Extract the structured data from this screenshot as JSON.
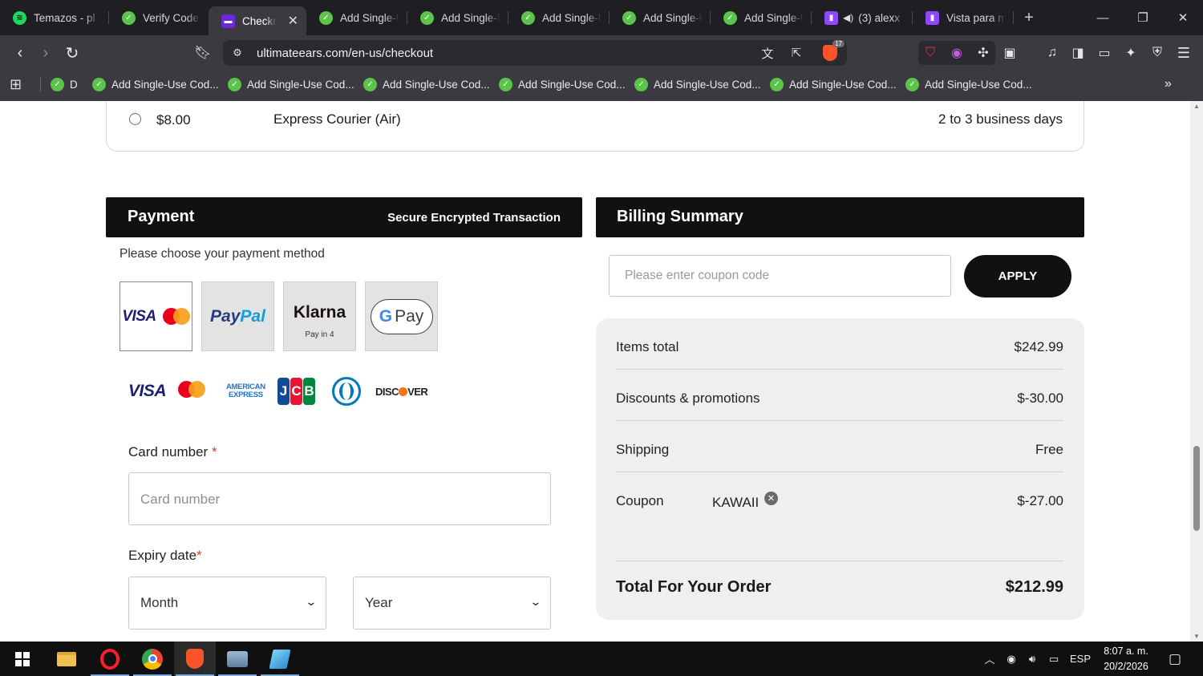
{
  "browser": {
    "tabs": [
      {
        "title": "Temazos - pl",
        "favicon": "spotify-icon",
        "active": false
      },
      {
        "title": "Verify Codes",
        "favicon": "check-icon",
        "active": false
      },
      {
        "title": "Checkout",
        "favicon": "checkout-icon",
        "active": true
      },
      {
        "title": "Add Single-U",
        "favicon": "check-icon",
        "active": false
      },
      {
        "title": "Add Single-U",
        "favicon": "check-icon",
        "active": false
      },
      {
        "title": "Add Single-U",
        "favicon": "check-icon",
        "active": false
      },
      {
        "title": "Add Single-U",
        "favicon": "check-icon",
        "active": false
      },
      {
        "title": "Add Single-U",
        "favicon": "check-icon",
        "active": false
      },
      {
        "title": "(3) alexx",
        "favicon": "twitch-icon",
        "active": false
      },
      {
        "title": "Vista para m",
        "favicon": "twitch-icon",
        "active": false
      }
    ],
    "url": "ultimateears.com/en-us/checkout",
    "brave_shield_count": "17",
    "bookmarks": [
      {
        "label": "D"
      },
      {
        "label": "Add Single-Use Cod..."
      },
      {
        "label": "Add Single-Use Cod..."
      },
      {
        "label": "Add Single-Use Cod..."
      },
      {
        "label": "Add Single-Use Cod..."
      },
      {
        "label": "Add Single-Use Cod..."
      },
      {
        "label": "Add Single-Use Cod..."
      },
      {
        "label": "Add Single-Use Cod..."
      }
    ]
  },
  "shipping": {
    "price": "$8.00",
    "method": "Express Courier (Air)",
    "eta": "2 to 3 business days"
  },
  "payment": {
    "title": "Payment",
    "secure_text": "Secure Encrypted Transaction",
    "choose_text": "Please choose your payment method",
    "methods": {
      "card_visa": "VISA",
      "paypal_a": "Pay",
      "paypal_b": "Pal",
      "klarna": "Klarna",
      "klarna_sub": "Pay in 4",
      "gpay_g": "G",
      "gpay_text": "Pay"
    },
    "card_brands": {
      "visa": "VISA",
      "amex_1": "AMERICAN",
      "amex_2": "EXPRESS",
      "jcb_j": "J",
      "jcb_c": "C",
      "jcb_b": "B",
      "discover_a": "DISC",
      "discover_b": "VER"
    },
    "card_number_label": "Card number",
    "card_number_placeholder": "Card number",
    "required_mark": "*",
    "expiry_label": "Expiry date",
    "month_value": "Month",
    "year_value": "Year"
  },
  "billing": {
    "title": "Billing Summary",
    "coupon_placeholder": "Please enter coupon code",
    "apply_label": "APPLY",
    "rows": [
      {
        "label": "Items total",
        "value": "$242.99"
      },
      {
        "label": "Discounts & promotions",
        "value": "$-30.00"
      },
      {
        "label": "Shipping",
        "value": "Free"
      },
      {
        "label": "Coupon",
        "code": "KAWAII",
        "value": "$-27.00"
      }
    ],
    "total_label": "Total For Your Order",
    "total_value": "$212.99"
  },
  "taskbar": {
    "language": "ESP",
    "time": "8:07 a. m.",
    "date": "20/2/2026"
  },
  "colors": {
    "accent_dark": "#111111",
    "required": "#e4322b",
    "summary_bg": "#efefef"
  }
}
